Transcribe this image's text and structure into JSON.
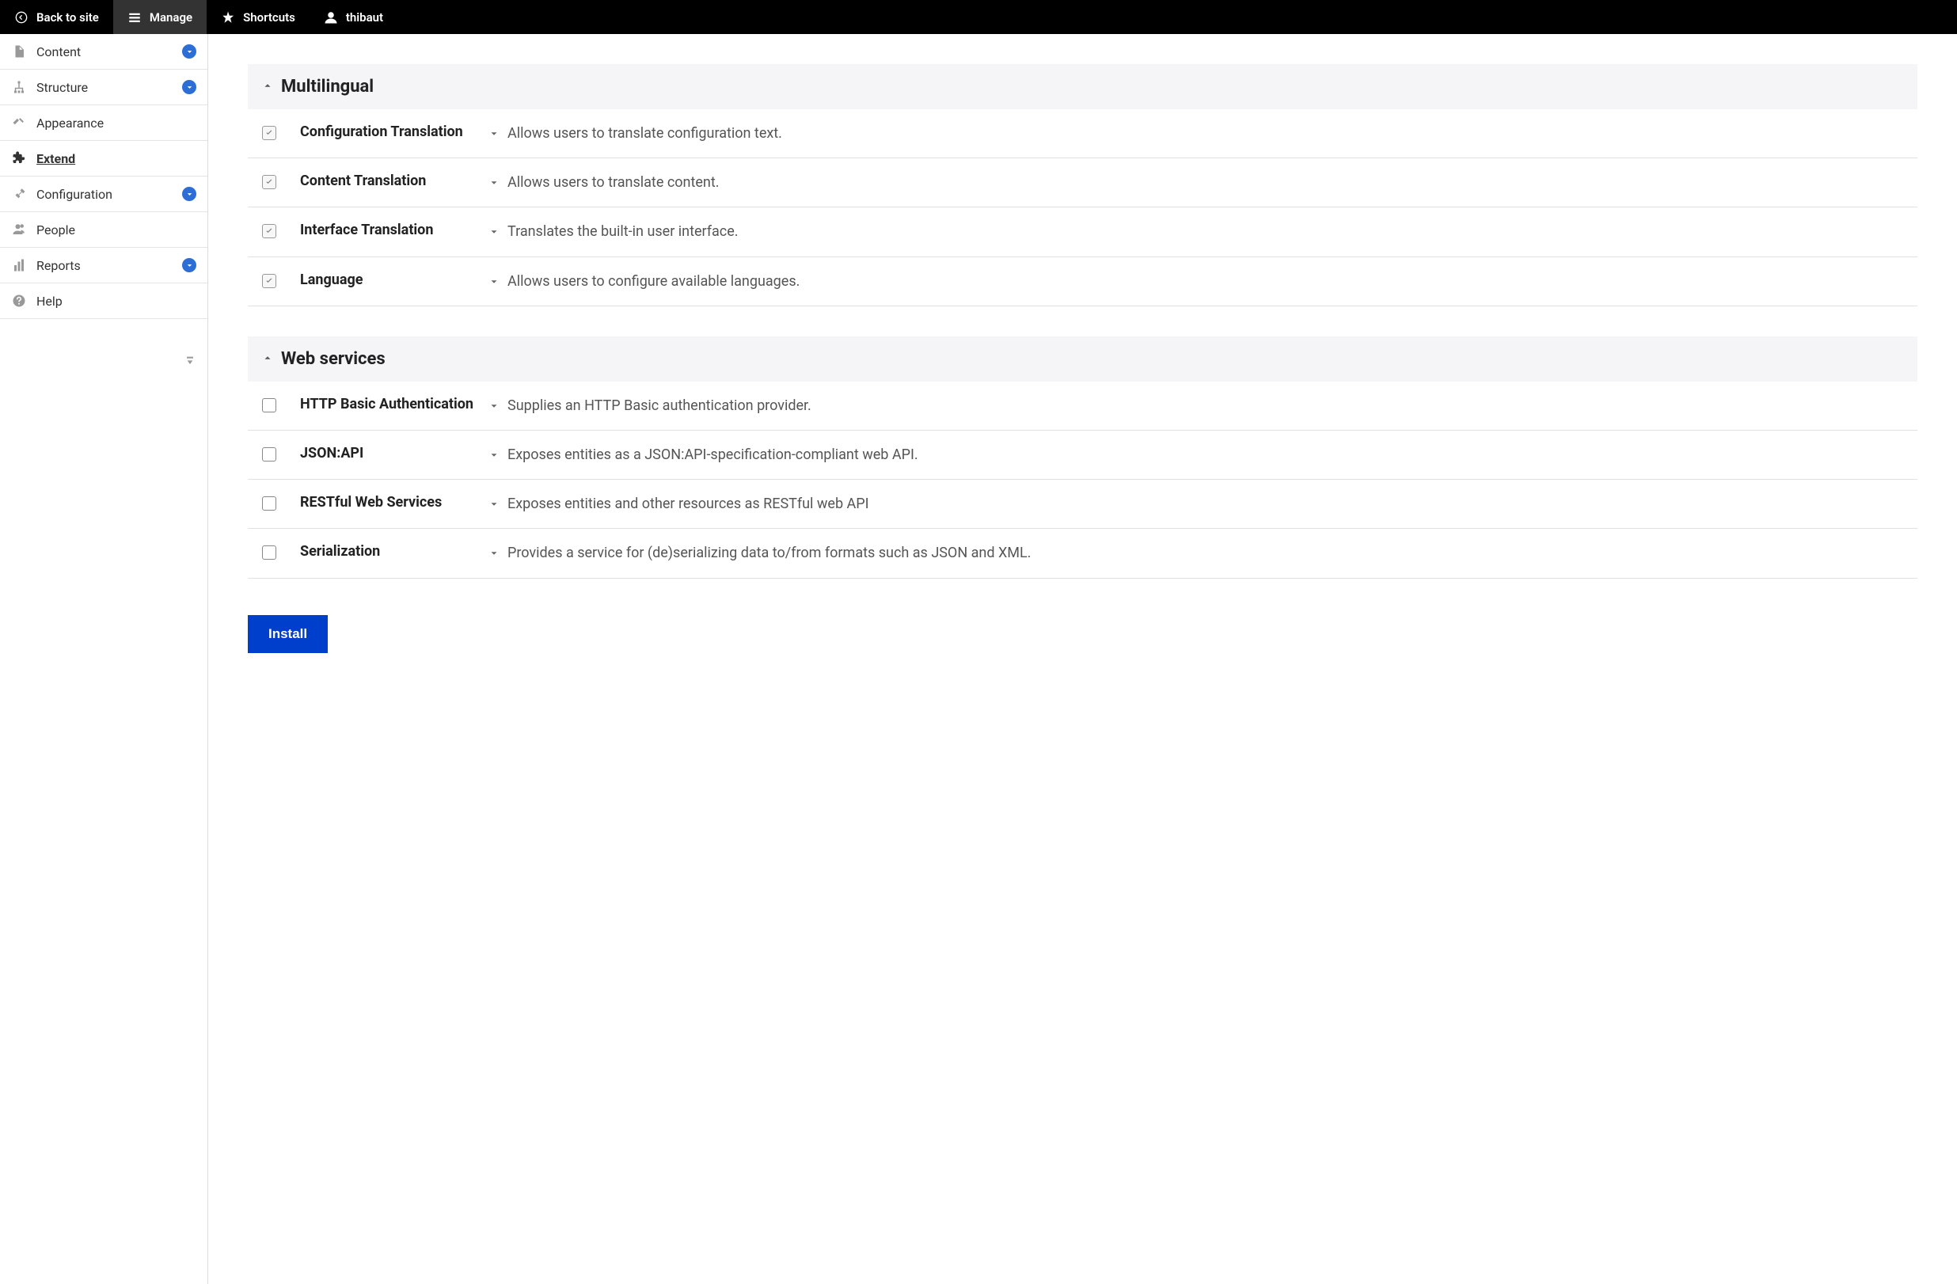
{
  "toolbar": {
    "back": "Back to site",
    "manage": "Manage",
    "shortcuts": "Shortcuts",
    "user": "thibaut"
  },
  "sidebar": {
    "items": [
      {
        "label": "Content",
        "icon": "page",
        "expandable": true,
        "active": false
      },
      {
        "label": "Structure",
        "icon": "structure",
        "expandable": true,
        "active": false
      },
      {
        "label": "Appearance",
        "icon": "appearance",
        "expandable": false,
        "active": false
      },
      {
        "label": "Extend",
        "icon": "extend",
        "expandable": false,
        "active": true
      },
      {
        "label": "Configuration",
        "icon": "config",
        "expandable": true,
        "active": false
      },
      {
        "label": "People",
        "icon": "people",
        "expandable": false,
        "active": false
      },
      {
        "label": "Reports",
        "icon": "reports",
        "expandable": true,
        "active": false
      },
      {
        "label": "Help",
        "icon": "help",
        "expandable": false,
        "active": false
      }
    ]
  },
  "sections": [
    {
      "title": "Multilingual",
      "modules": [
        {
          "name": "Configuration Translation",
          "desc": "Allows users to translate configuration text.",
          "checked": true
        },
        {
          "name": "Content Translation",
          "desc": "Allows users to translate content.",
          "checked": true
        },
        {
          "name": "Interface Translation",
          "desc": "Translates the built-in user interface.",
          "checked": true
        },
        {
          "name": "Language",
          "desc": "Allows users to configure available languages.",
          "checked": true
        }
      ]
    },
    {
      "title": "Web services",
      "modules": [
        {
          "name": "HTTP Basic Authentication",
          "desc": "Supplies an HTTP Basic authentication provider.",
          "checked": false
        },
        {
          "name": "JSON:API",
          "desc": "Exposes entities as a JSON:API-specification-compliant web API.",
          "checked": false
        },
        {
          "name": "RESTful Web Services",
          "desc": "Exposes entities and other resources as RESTful web API",
          "checked": false
        },
        {
          "name": "Serialization",
          "desc": "Provides a service for (de)serializing data to/from formats such as JSON and XML.",
          "checked": false
        }
      ]
    }
  ],
  "install_button": "Install"
}
